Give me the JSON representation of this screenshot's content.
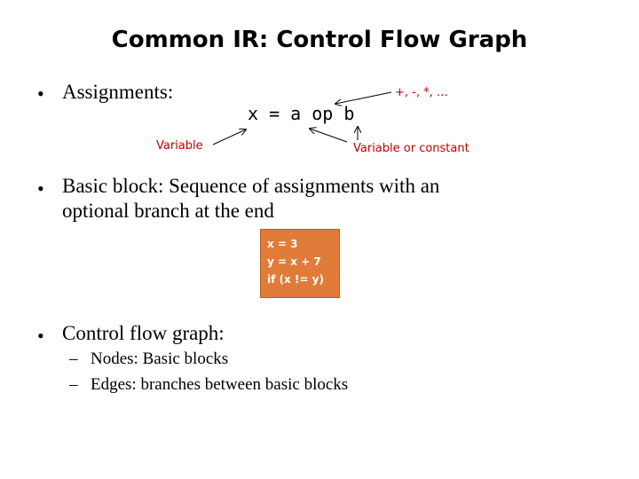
{
  "title": "Common IR: Control Flow Graph",
  "bullets": [
    {
      "text": "Assignments:"
    },
    {
      "line1": "Basic block: Sequence of assignments with an",
      "line2": "optional branch at the end"
    },
    {
      "text": "Control flow graph:"
    }
  ],
  "assignment": {
    "code": "x = a op b",
    "annotations": {
      "operators": "+, -, *, …",
      "variable": "Variable",
      "variable_or_constant": "Variable or constant"
    }
  },
  "basic_block": {
    "lines": [
      "x = 3",
      "y = x + 7",
      "if (x != y)"
    ],
    "fill_color": "#e07b39"
  },
  "cfg_subbullets": [
    "Nodes: Basic blocks",
    "Edges: branches between basic blocks"
  ],
  "colors": {
    "annotation": "#c00000",
    "text": "#000000"
  },
  "bullet_glyph": "•",
  "dash_glyph": "–"
}
